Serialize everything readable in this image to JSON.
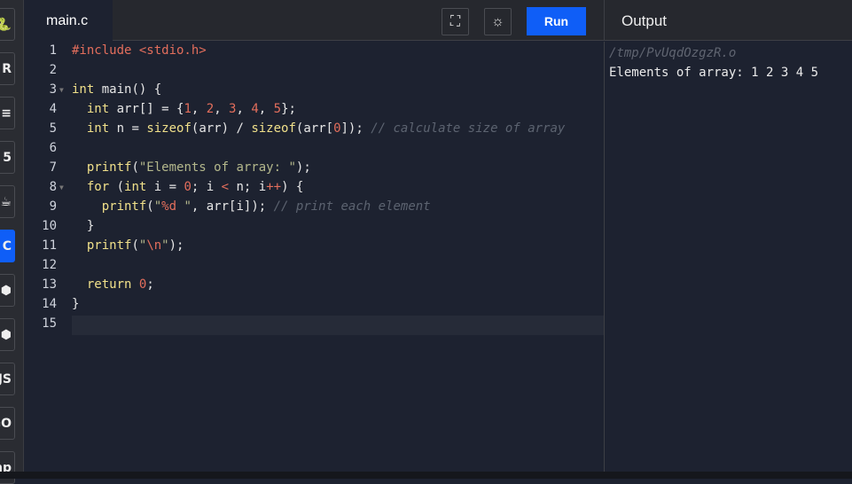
{
  "sidebar": {
    "items": [
      {
        "icon": "python-icon",
        "glyph": "🐍"
      },
      {
        "icon": "r-icon",
        "glyph": "R"
      },
      {
        "icon": "database-icon",
        "glyph": "≡"
      },
      {
        "icon": "html5-icon",
        "glyph": "5"
      },
      {
        "icon": "java-icon",
        "glyph": "☕"
      },
      {
        "icon": "c-icon",
        "glyph": "C",
        "active": true
      },
      {
        "icon": "cpp-icon",
        "glyph": "⬢"
      },
      {
        "icon": "csharp-icon",
        "glyph": "⬢"
      },
      {
        "icon": "javascript-icon",
        "glyph": "JS"
      },
      {
        "icon": "go-icon",
        "glyph": "GO"
      },
      {
        "icon": "php-icon",
        "glyph": "php"
      }
    ]
  },
  "editor": {
    "tab": "main.c",
    "run_label": "Run",
    "fullscreen_icon": "fullscreen-icon",
    "theme_icon": "sun-icon",
    "lines": [
      [
        [
          "inc",
          "#include "
        ],
        [
          "num",
          "<stdio.h>"
        ]
      ],
      [],
      [
        [
          "kw",
          "int"
        ],
        [
          "",
          "  main() {"
        ]
      ],
      [
        [
          "",
          "    "
        ],
        [
          "kw",
          "int"
        ],
        [
          "",
          "  arr[] = {"
        ],
        [
          "num",
          "1"
        ],
        [
          "",
          ", "
        ],
        [
          "num",
          "2"
        ],
        [
          "",
          ", "
        ],
        [
          "num",
          "3"
        ],
        [
          "",
          ", "
        ],
        [
          "num",
          "4"
        ],
        [
          "",
          ", "
        ],
        [
          "num",
          "5"
        ],
        [
          "",
          "};"
        ]
      ],
      [
        [
          "",
          "    "
        ],
        [
          "kw",
          "int"
        ],
        [
          "",
          "  n = "
        ],
        [
          "kw",
          "sizeof"
        ],
        [
          "",
          "(arr) / "
        ],
        [
          "kw",
          "sizeof"
        ],
        [
          "",
          "(arr["
        ],
        [
          "num",
          "0"
        ],
        [
          "",
          "]); "
        ],
        [
          "cm",
          "// calculate size of array"
        ]
      ],
      [],
      [
        [
          "",
          "    "
        ],
        [
          "kw",
          "printf"
        ],
        [
          "",
          "("
        ],
        [
          "str",
          "\"Elements of array: \""
        ],
        [
          "",
          ");"
        ]
      ],
      [
        [
          "",
          "    "
        ],
        [
          "kw",
          "for"
        ],
        [
          "",
          "  ("
        ],
        [
          "kw",
          "int"
        ],
        [
          "",
          "  i = "
        ],
        [
          "num",
          "0"
        ],
        [
          "",
          "; i "
        ],
        [
          "op",
          "<"
        ],
        [
          "",
          "  n; i"
        ],
        [
          "op",
          "++"
        ],
        [
          "",
          ") {"
        ]
      ],
      [
        [
          "",
          "        "
        ],
        [
          "kw",
          "printf"
        ],
        [
          "",
          "("
        ],
        [
          "str",
          "\""
        ],
        [
          "num",
          "%d"
        ],
        [
          "str",
          " \""
        ],
        [
          "",
          ", arr[i]); "
        ],
        [
          "cm",
          "// print each element"
        ]
      ],
      [
        [
          "",
          "    }"
        ]
      ],
      [
        [
          "",
          "    "
        ],
        [
          "kw",
          "printf"
        ],
        [
          "",
          "("
        ],
        [
          "str",
          "\""
        ],
        [
          "num",
          "\\n"
        ],
        [
          "str",
          "\""
        ],
        [
          "",
          ");"
        ]
      ],
      [],
      [
        [
          "",
          "    "
        ],
        [
          "kw",
          "return"
        ],
        [
          "",
          "  "
        ],
        [
          "num",
          "0"
        ],
        [
          "",
          ";"
        ]
      ],
      [
        [
          "",
          "}"
        ]
      ],
      []
    ],
    "fold_lines": [
      3,
      8
    ]
  },
  "output": {
    "title": "Output",
    "path": "/tmp/PvUqdOzgzR.o",
    "text": "Elements of array: 1 2 3 4 5"
  },
  "colors": {
    "accent": "#0f5ef7",
    "background": "#1d2230"
  }
}
